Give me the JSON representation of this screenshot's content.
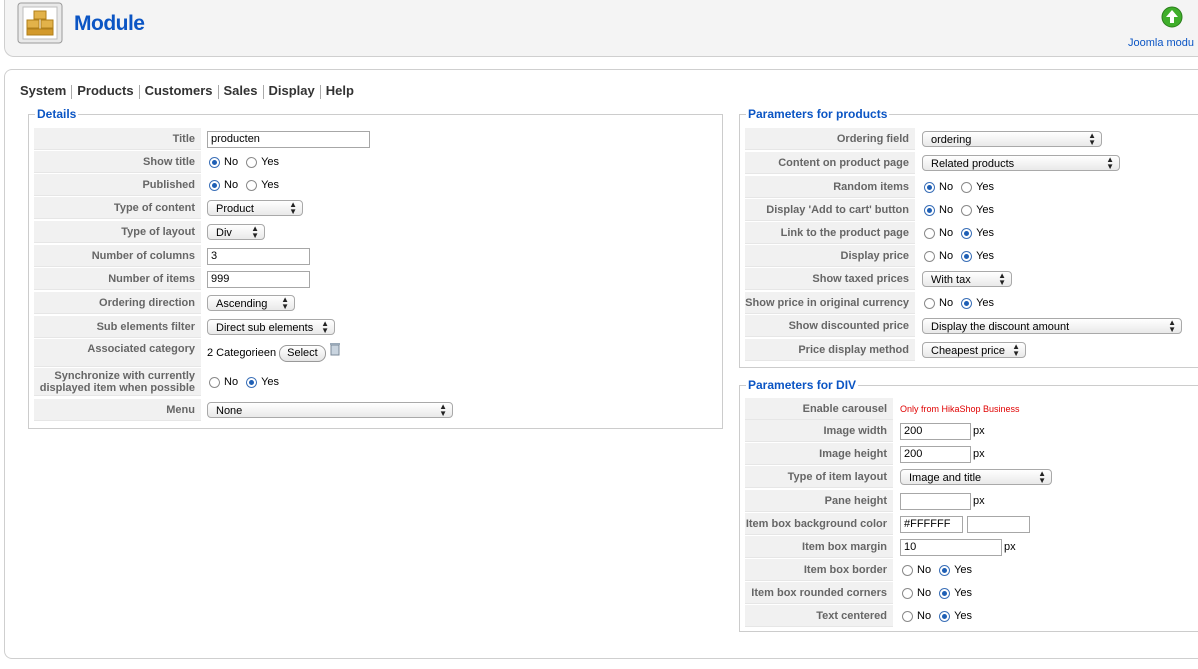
{
  "header": {
    "title": "Module",
    "joomla_label": "Joomla modu"
  },
  "nav": {
    "items": [
      "System",
      "Products",
      "Customers",
      "Sales",
      "Display",
      "Help"
    ]
  },
  "details": {
    "legend": "Details",
    "title_label": "Title",
    "title_value": "producten",
    "show_title_label": "Show title",
    "published_label": "Published",
    "type_content_label": "Type of content",
    "type_content_value": "Product",
    "type_layout_label": "Type of layout",
    "type_layout_value": "Div",
    "num_columns_label": "Number of columns",
    "num_columns_value": "3",
    "num_items_label": "Number of items",
    "num_items_value": "999",
    "ordering_dir_label": "Ordering direction",
    "ordering_dir_value": "Ascending",
    "sub_filter_label": "Sub elements filter",
    "sub_filter_value": "Direct sub elements",
    "assoc_cat_label": "Associated category",
    "assoc_cat_value": "2 Categorieen",
    "select_button": "Select",
    "sync_label_1": "Synchronize with currently",
    "sync_label_2": "displayed item when possible",
    "menu_label": "Menu",
    "menu_value": "None",
    "no": "No",
    "yes": "Yes"
  },
  "products": {
    "legend": "Parameters for products",
    "ordering_field_label": "Ordering field",
    "ordering_field_value": "ordering",
    "content_page_label": "Content on product page",
    "content_page_value": "Related products",
    "random_label": "Random items",
    "add_to_cart_label": "Display 'Add to cart' button",
    "link_label": "Link to the product page",
    "display_price_label": "Display price",
    "taxed_label": "Show taxed prices",
    "taxed_value": "With tax",
    "orig_currency_label": "Show price in original currency",
    "discounted_label": "Show discounted price",
    "discounted_value": "Display the discount amount",
    "price_method_label": "Price display method",
    "price_method_value": "Cheapest price",
    "no": "No",
    "yes": "Yes"
  },
  "div": {
    "legend": "Parameters for DIV",
    "carousel_label": "Enable carousel",
    "carousel_value": "Only from HikaShop Business",
    "img_width_label": "Image width",
    "img_width_value": "200",
    "img_height_label": "Image height",
    "img_height_value": "200",
    "item_layout_label": "Type of item layout",
    "item_layout_value": "Image and title",
    "pane_height_label": "Pane height",
    "pane_height_value": "",
    "bg_color_label": "Item box background color",
    "bg_color_value": "#FFFFFF",
    "margin_label": "Item box margin",
    "margin_value": "10",
    "border_label": "Item box border",
    "rounded_label": "Item box rounded corners",
    "centered_label": "Text centered",
    "px": "px",
    "no": "No",
    "yes": "Yes"
  },
  "colors": {
    "accent": "#0b55c4",
    "label_bg": "#f1f1f1",
    "warning": "#e00000"
  }
}
